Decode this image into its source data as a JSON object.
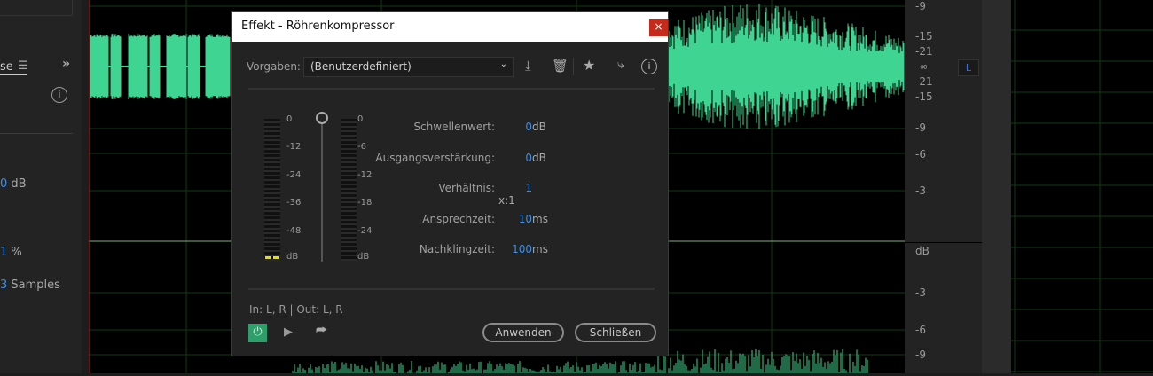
{
  "left_panel": {
    "tab_label_partial": "se",
    "values": [
      {
        "num": "0",
        "unit": "dB"
      },
      {
        "num": "1",
        "unit": "%"
      },
      {
        "num": "3",
        "unit": "Samples"
      }
    ]
  },
  "ruler": {
    "top_ticks": [
      "-9",
      "-15",
      "-21",
      "-∞",
      "-21",
      "-15",
      "-9",
      "-6",
      "-3"
    ],
    "unit": "dB",
    "bottom_ticks": [
      "-3",
      "-6",
      "-9"
    ],
    "channel": "L"
  },
  "dialog": {
    "title": "Effekt - Röhrenkompressor",
    "close": "×",
    "presets_label": "Vorgaben:",
    "preset_value": "(Benutzerdefiniert)",
    "input_meter_ticks": [
      "0",
      "-12",
      "-24",
      "-36",
      "-48",
      "dB"
    ],
    "output_meter_ticks": [
      "0",
      "-6",
      "-12",
      "-18",
      "-24",
      "dB"
    ],
    "params": [
      {
        "label": "Schwellenwert:",
        "value": "0",
        "unit": "dB"
      },
      {
        "label": "Ausgangsverstärkung:",
        "value": "0",
        "unit": "dB"
      },
      {
        "label": "Verhältnis:",
        "value": "1",
        "unit": "x:1"
      },
      {
        "label": "Ansprechzeit:",
        "value": "10",
        "unit": "ms"
      },
      {
        "label": "Nachklingzeit:",
        "value": "100",
        "unit": "ms"
      }
    ],
    "routing": "In: L, R | Out: L, R",
    "apply": "Anwenden",
    "close_button": "Schließen",
    "power_color": "#2e9e6a"
  },
  "colors": {
    "waveform": "#3fd491",
    "grid": "#0f3a14",
    "accent": "#3d8ee6"
  }
}
